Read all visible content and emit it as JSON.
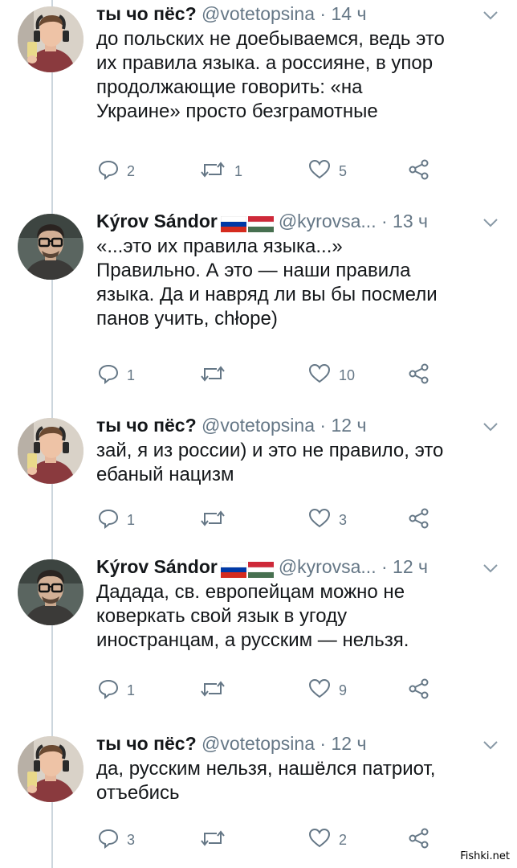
{
  "tweets": [
    {
      "author": "ты чо пёс?",
      "handle": "@votetopsina",
      "dot": "·",
      "time": "14 ч",
      "has_flags": false,
      "text": "до польских не доебываемся, ведь это\nих правила языка. а россияне, в упор\nпродолжающие говорить: «на\nУкраине» просто безграмотные",
      "replies": "2",
      "retweets": "1",
      "likes": "5",
      "avatar": "boy-selfie"
    },
    {
      "author": "Kýrov Sándor",
      "handle": "@kyrovsa...",
      "dot": "·",
      "time": "13 ч",
      "has_flags": true,
      "text": "«...это их правила языка...»\nПравильно. А это — наши правила\nязыка. Да и навряд ли вы бы посмели\nпанов учить, chłope)",
      "replies": "1",
      "retweets": "",
      "likes": "10",
      "avatar": "glasses-man"
    },
    {
      "author": "ты чо пёс?",
      "handle": "@votetopsina",
      "dot": "·",
      "time": "12 ч",
      "has_flags": false,
      "text": "зай, я из россии) и это не правило, это\nебаный нацизм",
      "replies": "1",
      "retweets": "",
      "likes": "3",
      "avatar": "boy-selfie"
    },
    {
      "author": "Kýrov Sándor",
      "handle": "@kyrovsa...",
      "dot": "·",
      "time": "12 ч",
      "has_flags": true,
      "text": "Дадада, св. европейцам можно не\nковеркать свой язык в угоду\nиностранцам, а русским — нельзя.",
      "replies": "1",
      "retweets": "",
      "likes": "9",
      "avatar": "glasses-man"
    },
    {
      "author": "ты чо пёс?",
      "handle": "@votetopsina",
      "dot": "·",
      "time": "12 ч",
      "has_flags": false,
      "text": "да, русским нельзя, нашёлся патриот,\nотъебись",
      "replies": "3",
      "retweets": "",
      "likes": "2",
      "avatar": "boy-selfie"
    }
  ],
  "watermark": "Fishki.net",
  "colors": {
    "text": "#14171a",
    "secondary": "#657786",
    "thread_line": "#ccd6dd",
    "flag_ru": [
      "#ffffff",
      "#0039a6",
      "#d52b1e"
    ],
    "flag_hu": [
      "#ce2939",
      "#ffffff",
      "#477050"
    ]
  }
}
